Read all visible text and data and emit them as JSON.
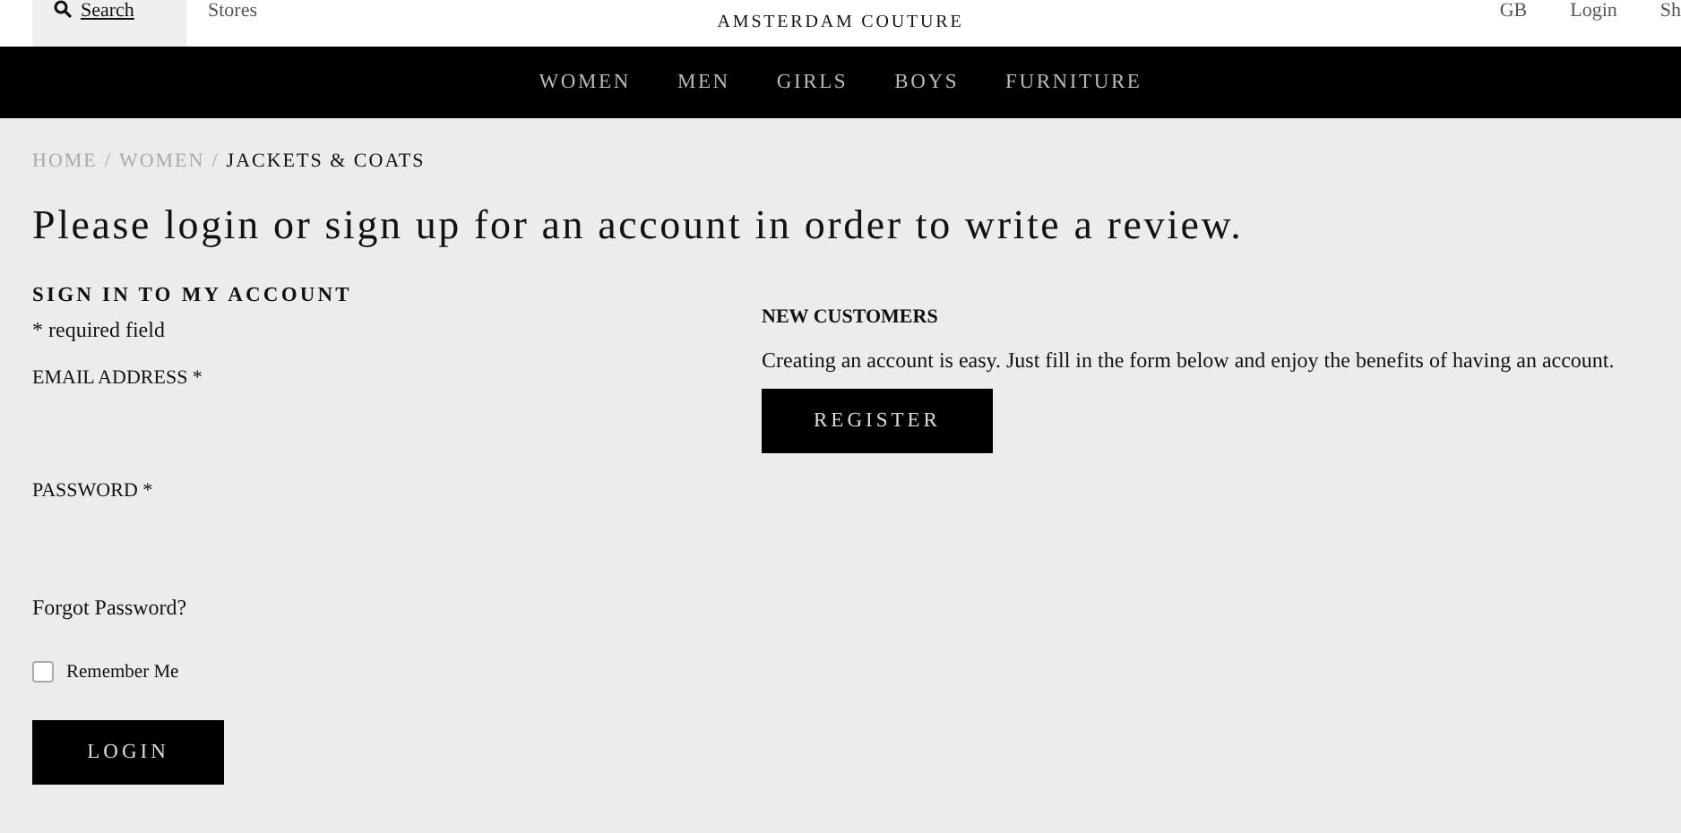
{
  "header": {
    "left_links": [
      {
        "label": "Search",
        "kind": "search"
      },
      {
        "label": "Stores",
        "kind": "plain"
      }
    ],
    "brand": "AMSTERDAM COUTURE",
    "right_links": [
      "GB",
      "Login",
      "Sh"
    ]
  },
  "nav": {
    "items": [
      "WOMEN",
      "MEN",
      "GIRLS",
      "BOYS",
      "FURNITURE"
    ]
  },
  "breadcrumb": [
    {
      "kind": "link",
      "label": "HOME",
      "current": false
    },
    {
      "kind": "separator",
      "label": "/"
    },
    {
      "kind": "link",
      "label": "WOMEN",
      "current": false
    },
    {
      "kind": "separator",
      "label": "/"
    },
    {
      "kind": "link",
      "label": "JACKETS & COATS",
      "current": true
    }
  ],
  "heading": "Please login or sign up for an account in order to write a review.",
  "sign_in": {
    "title": "SIGN IN TO MY ACCOUNT",
    "note": "* required field",
    "fields": [
      {
        "label": "EMAIL ADDRESS *"
      },
      {
        "label": "PASSWORD *"
      }
    ],
    "forgot": "Forgot Password?",
    "remember": {
      "label": "Remember Me",
      "checked": false
    },
    "button": "LOGIN"
  },
  "new_customers": {
    "title": "NEW CUSTOMERS",
    "text": "Creating an account is easy. Just fill in the form below and enjoy the benefits of having an account.",
    "button": "REGISTER"
  }
}
